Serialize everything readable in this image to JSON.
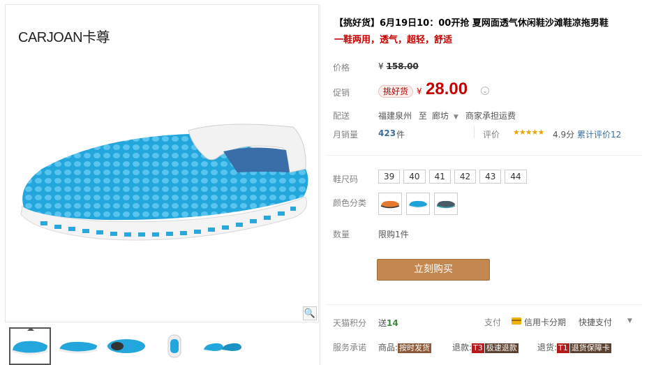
{
  "gallery": {
    "brand": "CARJOAN卡尊",
    "zoom_icon": "magnifier-icon",
    "thumbnails": [
      "shoe-side-blue",
      "shoe-side-blue-2",
      "shoe-top-blue",
      "shoe-back-blue",
      "shoe-pair-blue"
    ]
  },
  "product": {
    "title": "【挑好货】6月19日10：00开抢 夏网面透气休闲鞋沙滩鞋凉拖男鞋",
    "subtitle": "一鞋两用，透气，超轻，舒适"
  },
  "price": {
    "orig_label": "价格",
    "orig_symbol": "¥",
    "orig_value": "158.00",
    "promo_label": "促销",
    "promo_tag": "挑好货",
    "promo_symbol": "¥",
    "promo_value": "28.00"
  },
  "shipping": {
    "label": "配送",
    "from": "福建泉州",
    "to_word": "至",
    "dest": "廊坊",
    "fee": "商家承担运费"
  },
  "sales": {
    "label": "月销量",
    "count": "423",
    "unit": "件",
    "review_label": "评价",
    "stars": "★★★★★",
    "rating": "4.9分",
    "review_count": "累计评价12"
  },
  "sku": {
    "size_label": "鞋尺码",
    "sizes": [
      "39",
      "40",
      "41",
      "42",
      "43",
      "44"
    ],
    "color_label": "颜色分类",
    "colors": [
      "#e57a2e",
      "#1ea3d8",
      "#4a5a66"
    ],
    "qty_label": "数量",
    "limit": "限购1件"
  },
  "buy_button": "立刻购买",
  "extras": {
    "points_label": "天猫积分",
    "points_prefix": "送",
    "points_value": "14",
    "pay_label": "支付",
    "credit": "信用卡分期",
    "quick_pay": "快捷支付",
    "service_label": "服务承诺",
    "svc1_prefix": "商品:",
    "svc1_badge": "按时发货",
    "svc2_prefix": "退款:",
    "svc2_code": "T3",
    "svc2_badge": "极速退款",
    "svc3_prefix": "退货:",
    "svc3_code": "T1",
    "svc3_badge": "退货保障卡"
  }
}
